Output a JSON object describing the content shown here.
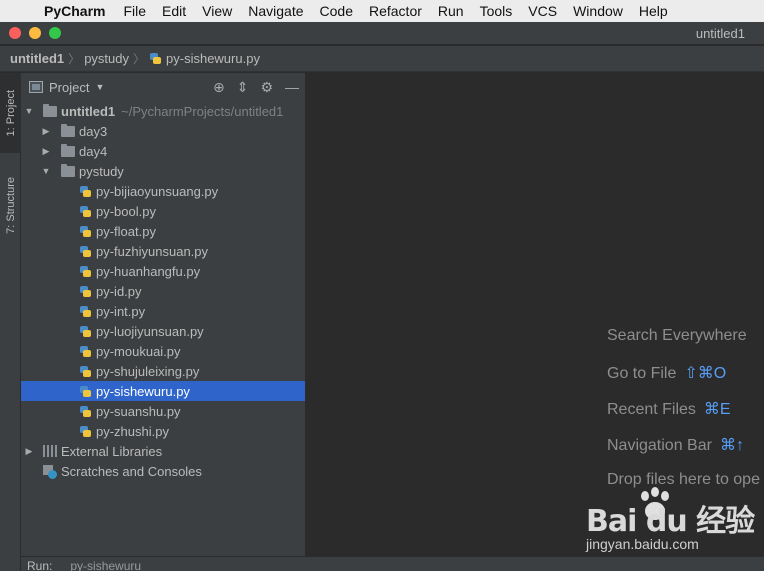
{
  "menubar": {
    "apple_icon": "apple-logo",
    "app_name": "PyCharm",
    "items": [
      "File",
      "Edit",
      "View",
      "Navigate",
      "Code",
      "Refactor",
      "Run",
      "Tools",
      "VCS",
      "Window",
      "Help"
    ]
  },
  "window": {
    "title": "untitled1"
  },
  "breadcrumb": {
    "items": [
      "untitled1",
      "pystudy",
      "py-sishewuru.py"
    ]
  },
  "tool_strip": {
    "project_tab": "1: Project",
    "structure_tab": "7: Structure"
  },
  "project_panel": {
    "title": "Project",
    "view_mode_icon": "chevron-down-icon",
    "header_icons": [
      "locate-icon",
      "collapse-icon",
      "gear-icon",
      "minimize-icon"
    ],
    "root": {
      "name": "untitled1",
      "path": "~/PycharmProjects/untitled1"
    },
    "folders": [
      "day3",
      "day4",
      "pystudy"
    ],
    "files": [
      "py-bijiaoyunsuang.py",
      "py-bool.py",
      "py-float.py",
      "py-fuzhiyunsuan.py",
      "py-huanhangfu.py",
      "py-id.py",
      "py-int.py",
      "py-luojiyunsuan.py",
      "py-moukuai.py",
      "py-shujuleixing.py",
      "py-sishewuru.py",
      "py-suanshu.py",
      "py-zhushi.py"
    ],
    "selected_file": "py-sishewuru.py",
    "external_libraries": "External Libraries",
    "scratches": "Scratches and Consoles"
  },
  "editor_hints": {
    "search_everywhere": "Search Everywhere",
    "go_to_file": "Go to File",
    "go_to_file_key": "⇧⌘O",
    "recent_files": "Recent Files",
    "recent_files_key": "⌘E",
    "navigation_bar": "Navigation Bar",
    "navigation_bar_key": "⌘↑",
    "drop_files": "Drop files here to ope"
  },
  "run_bar": {
    "label": "Run:",
    "target": "py-sishewuru"
  },
  "watermark": {
    "logo_text": "Bai du 经验",
    "url": "jingyan.baidu.com"
  },
  "colors": {
    "selection": "#2f65ca",
    "shortcut": "#589df6",
    "panel_bg": "#3c3f41",
    "editor_bg": "#2b2b2b"
  }
}
